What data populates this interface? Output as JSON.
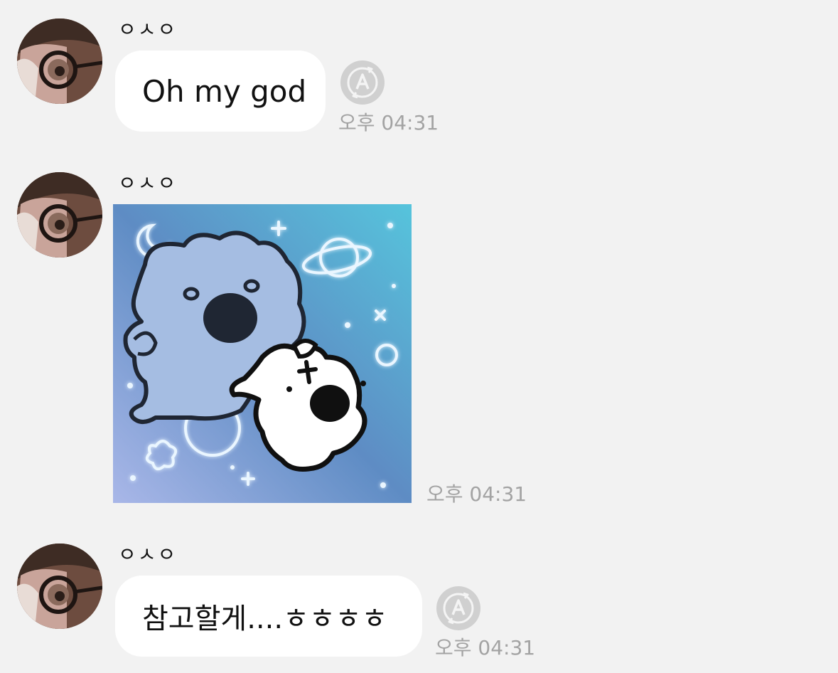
{
  "messages": [
    {
      "sender": "ㅇㅅㅇ",
      "type": "text",
      "text": "Oh my god",
      "time": "오후 04:31",
      "translate_icon": "translate-a-icon"
    },
    {
      "sender": "ㅇㅅㅇ",
      "type": "sticker",
      "sticker_icon": "sticker-image",
      "time": "오후 04:31"
    },
    {
      "sender": "ㅇㅅㅇ",
      "type": "text",
      "text": "참고할게....ㅎㅎㅎㅎ",
      "time": "오후 04:31",
      "translate_icon": "translate-a-icon"
    }
  ],
  "colors": {
    "background": "#f2f2f2",
    "bubble": "#ffffff",
    "timestamp": "#a3a3a3",
    "icon": "#cfcfcf"
  }
}
